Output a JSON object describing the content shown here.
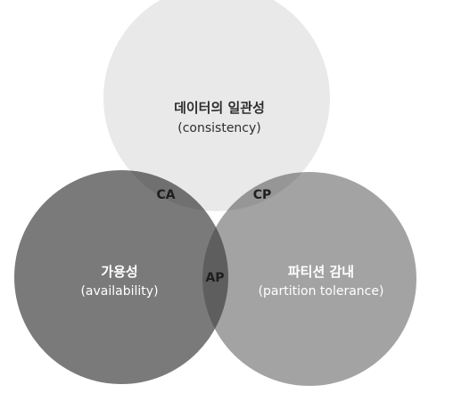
{
  "diagram": {
    "sets": [
      {
        "id": "consistency",
        "title": "데이터의 일관성",
        "subtitle": "(consistency)",
        "fill": "#e9e9e9",
        "text_color": "#2e2e2e"
      },
      {
        "id": "availability",
        "title": "가용성",
        "subtitle": "(availability)",
        "fill": "#7a7a7a",
        "text_color": "#ffffff"
      },
      {
        "id": "partition",
        "title": "파티션 감내",
        "subtitle": "(partition tolerance)",
        "fill": "#a3a3a3",
        "text_color": "#ffffff"
      }
    ],
    "intersections": {
      "ca": {
        "label": "CA",
        "fill": "#707070",
        "text_color": "#1e1e1e"
      },
      "cp": {
        "label": "CP",
        "fill": "#969696",
        "text_color": "#1e1e1e"
      },
      "ap": {
        "label": "AP",
        "fill": "#5e5e5e",
        "text_color": "#1e1e1e"
      }
    }
  }
}
